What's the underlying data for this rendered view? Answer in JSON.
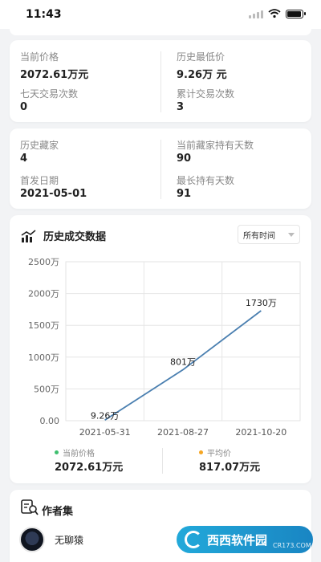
{
  "status_bar": {
    "time": "11:43"
  },
  "stats_card_1": {
    "current_price_label": "当前价格",
    "current_price_value": "2072.61万元",
    "lowest_price_label": "历史最低价",
    "lowest_price_value": "9.26万 元",
    "seven_day_trades_label": "七天交易次数",
    "seven_day_trades_value": "0",
    "total_trades_label": "累计交易次数",
    "total_trades_value": "3"
  },
  "stats_card_2": {
    "history_collectors_label": "历史藏家",
    "history_collectors_value": "4",
    "current_holder_days_label": "当前藏家持有天数",
    "current_holder_days_value": "90",
    "first_date_label": "首发日期",
    "first_date_value": "2021-05-01",
    "longest_hold_label": "最长持有天数",
    "longest_hold_value": "91"
  },
  "chart_section": {
    "title": "历史成交数据",
    "range_select": "所有时间"
  },
  "chart_data": {
    "type": "line",
    "x": [
      "2021-05-31",
      "2021-08-27",
      "2021-10-20"
    ],
    "values": [
      9.26,
      801,
      1730
    ],
    "point_labels": [
      "9.26万",
      "801万",
      "1730万"
    ],
    "y_ticks": [
      "0.00",
      "500万",
      "1000万",
      "1500万",
      "2000万",
      "2500万"
    ],
    "y_tick_values": [
      0,
      500,
      1000,
      1500,
      2000,
      2500
    ],
    "ylim": [
      0,
      2500
    ],
    "grid": true,
    "line_color": "#4a7fb0"
  },
  "legend": {
    "current_label": "当前价格",
    "current_value": "2072.61万元",
    "current_color": "#3fbf6f",
    "avg_label": "平均价",
    "avg_value": "817.07万元",
    "avg_color": "#f5a623"
  },
  "author_section": {
    "title": "作者集",
    "author_name": "无聊猿"
  },
  "watermark": {
    "text": "西西软件园",
    "sub": "CR173.COM"
  }
}
